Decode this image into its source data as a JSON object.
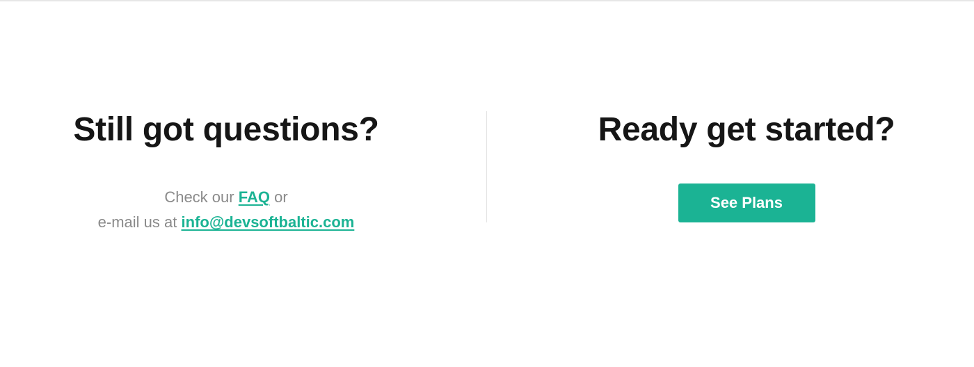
{
  "left": {
    "heading": "Still got questions?",
    "line1_prefix": "Check our",
    "faq_link": "FAQ",
    "line1_suffix": "or",
    "line2_prefix": "e-mail us at",
    "email_link": "info@devsoftbaltic.com"
  },
  "right": {
    "heading": "Ready get started?",
    "cta_button": "See Plans"
  },
  "colors": {
    "accent": "#1bb394",
    "heading_text": "#161616",
    "muted_text": "#8a8a8a",
    "background": "#ffffff"
  }
}
